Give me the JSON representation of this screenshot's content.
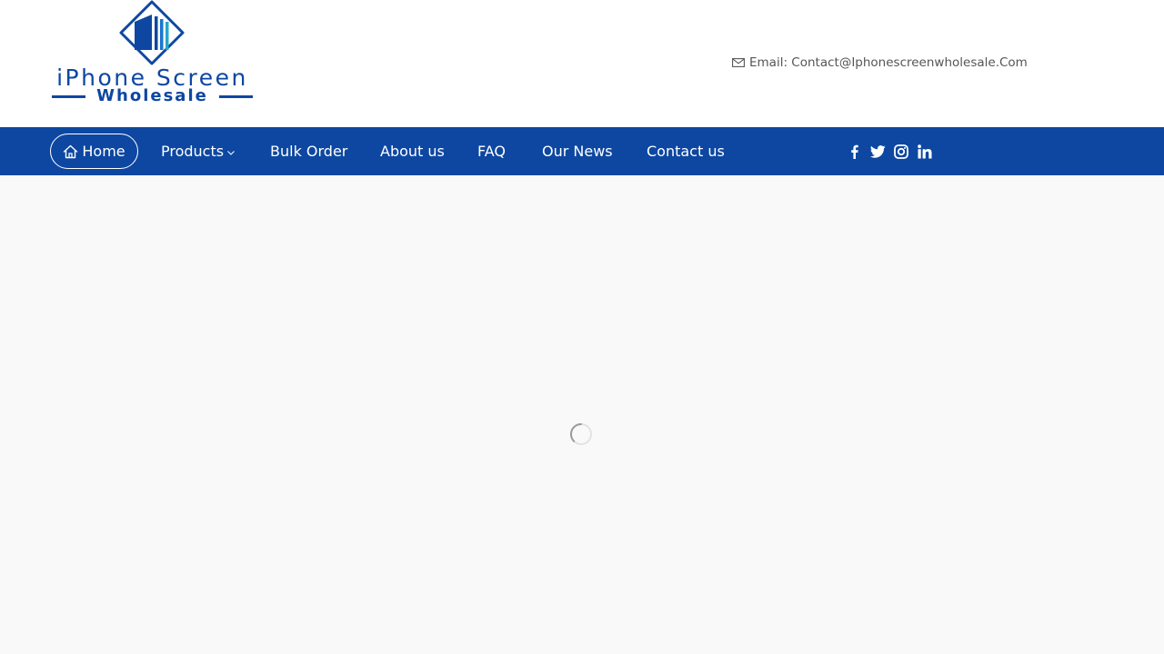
{
  "logo": {
    "line1": "iPhone Screen",
    "line2": "Wholesale",
    "icon": "building-diamond-logo-icon"
  },
  "contact": {
    "icon": "envelope-icon",
    "text": "Email: Contact@Iphonescreenwholesale.Com"
  },
  "nav": {
    "items": [
      {
        "label": "Home",
        "icon": "home-icon",
        "active": true
      },
      {
        "label": "Products",
        "icon": "chevron-down-icon"
      },
      {
        "label": "Bulk Order"
      },
      {
        "label": "About us"
      },
      {
        "label": "FAQ"
      },
      {
        "label": "Our News"
      },
      {
        "label": "Contact us"
      }
    ],
    "social": [
      "facebook-icon",
      "twitter-icon",
      "instagram-icon",
      "linkedin-icon"
    ]
  },
  "content": {
    "state": "loading",
    "icon": "loading-spinner-icon"
  },
  "colors": {
    "brand": "#0d47a1",
    "logo_accent": "#26a6c9",
    "page_background": "#f9f9f9",
    "header_background": "#ffffff"
  }
}
